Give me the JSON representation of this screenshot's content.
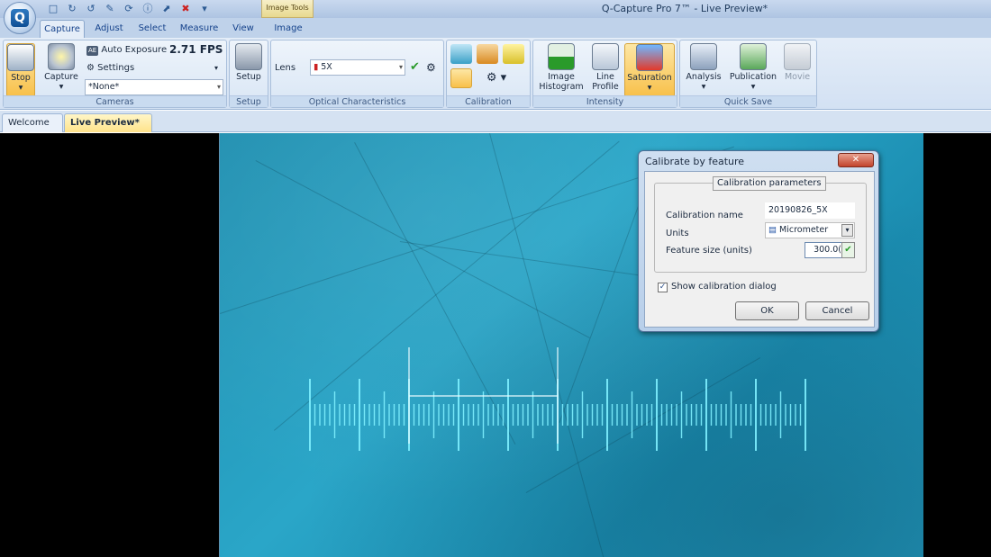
{
  "window": {
    "title": "Q-Capture Pro 7™ - Live Preview*",
    "context_tab": "Image Tools",
    "app_logo": "Q"
  },
  "tabs": [
    "Capture",
    "Adjust",
    "Select",
    "Measure",
    "View",
    "Image"
  ],
  "ribbon": {
    "cameras": {
      "label": "Cameras",
      "stop": "Stop",
      "capture": "Capture",
      "auto_exposure": "Auto Exposure",
      "auto_exposure_badge": "AE",
      "fps": "2.71 FPS",
      "settings": "Settings",
      "preset": "*None*"
    },
    "setup": {
      "label": "Setup",
      "button": "Setup"
    },
    "optical": {
      "label": "Optical Characteristics",
      "lens_label": "Lens",
      "lens_value": "5X"
    },
    "calibration": {
      "label": "Calibration"
    },
    "intensity": {
      "label": "Intensity",
      "histogram": "Image\nHistogram",
      "line_profile": "Line\nProfile",
      "saturation": "Saturation"
    },
    "quicksave": {
      "label": "Quick Save",
      "analysis": "Analysis",
      "publication": "Publication",
      "movie": "Movie"
    }
  },
  "doc_tabs": [
    {
      "label": "Welcome"
    },
    {
      "label": "Live Preview*"
    }
  ],
  "dialog": {
    "title": "Calibrate by feature",
    "group": "Calibration parameters",
    "name_label": "Calibration name",
    "name_value": "20190826_5X",
    "units_label": "Units",
    "units_value": "Micrometer",
    "size_label": "Feature size  (units)",
    "size_value": "300.0(",
    "show_dialog": "Show calibration dialog",
    "show_dialog_checked": true,
    "ok": "OK",
    "cancel": "Cancel"
  },
  "colors": {
    "ribbon_bg": "#dbe7f5",
    "preview": "#2aa6c8",
    "scale": "#7ff0ff",
    "highlight": "#f8c04a"
  }
}
